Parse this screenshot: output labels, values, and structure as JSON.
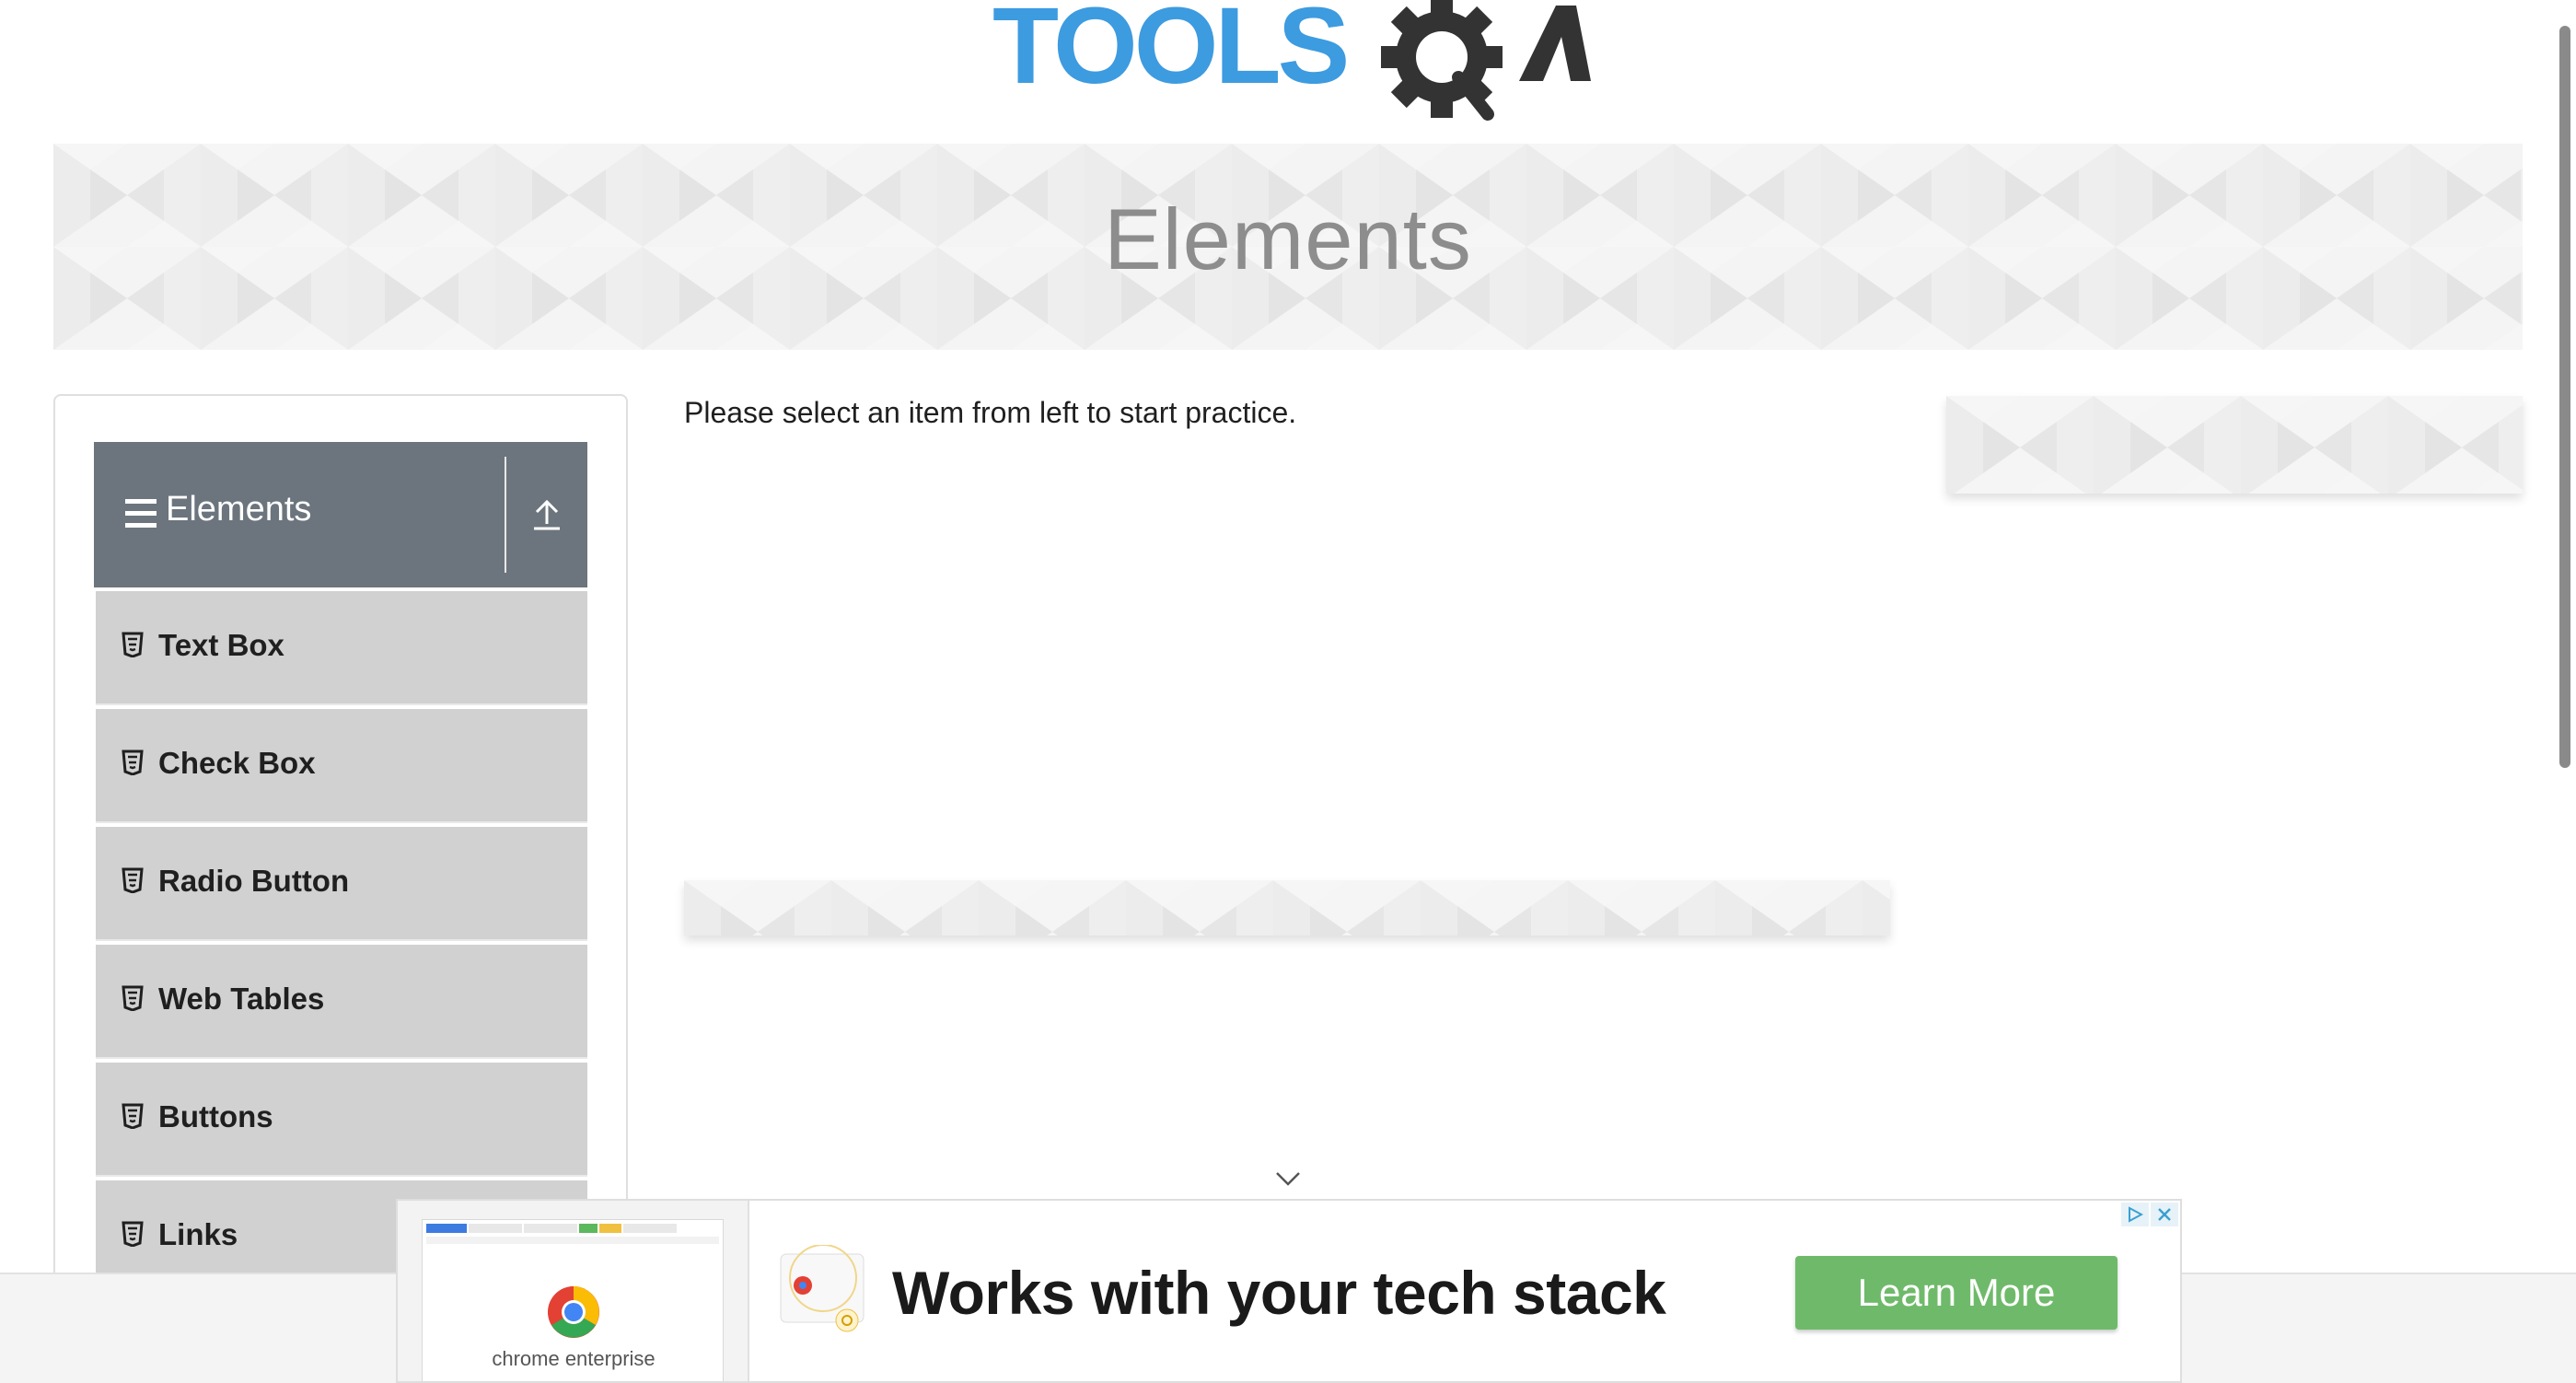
{
  "logo": {
    "text": "TOOLSQA"
  },
  "banner": {
    "title": "Elements"
  },
  "sidebar": {
    "group": {
      "title": "Elements"
    },
    "items": [
      {
        "label": "Text Box"
      },
      {
        "label": "Check Box"
      },
      {
        "label": "Radio Button"
      },
      {
        "label": "Web Tables"
      },
      {
        "label": "Buttons"
      },
      {
        "label": "Links"
      }
    ]
  },
  "main": {
    "message": "Please select an item from left to start practice."
  },
  "ad": {
    "thumb_label": "chrome enterprise",
    "headline": "Works with your tech stack",
    "cta": "Learn More"
  },
  "colors": {
    "logo_blue": "#3d9be0",
    "logo_dark": "#3a3a3a",
    "sidebar_header": "#6c757d",
    "sidebar_item": "#d1d1d1",
    "cta_green": "#6fba6a"
  }
}
